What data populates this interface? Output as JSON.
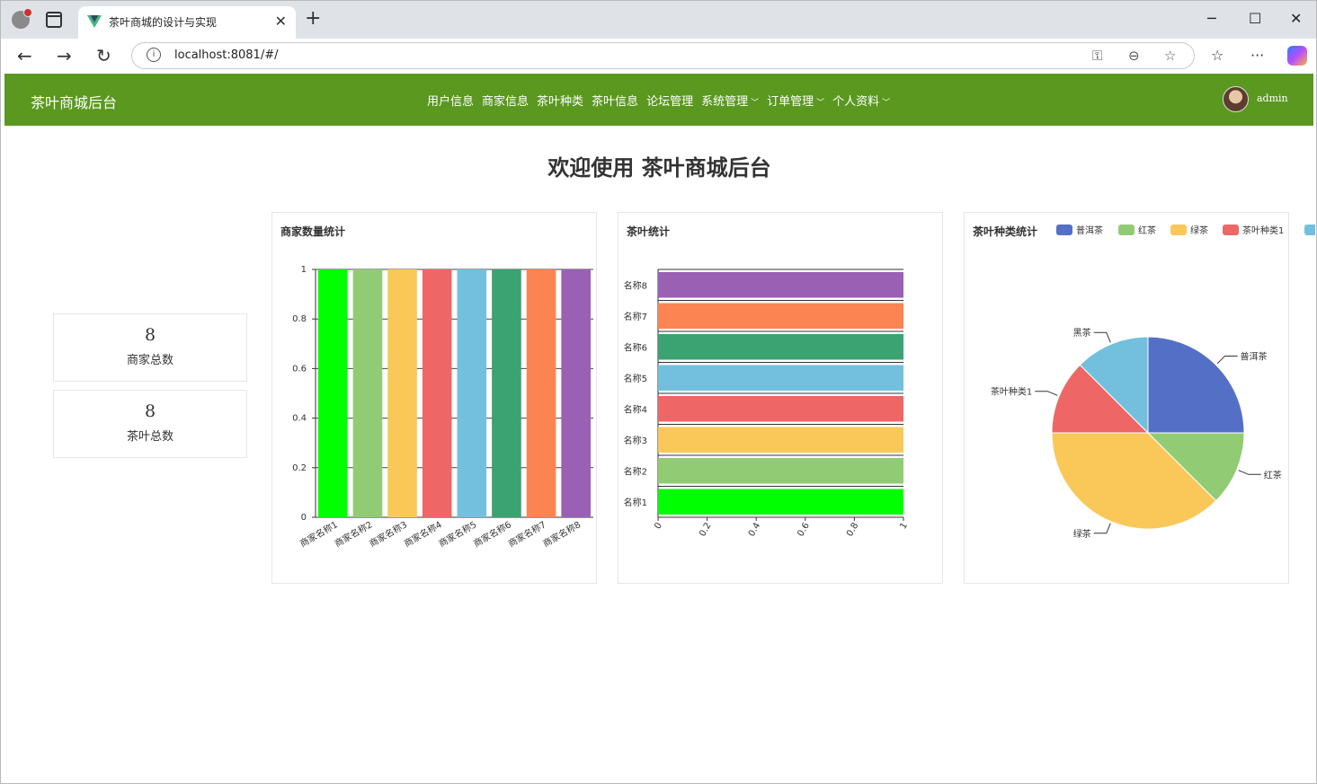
{
  "browser": {
    "tab_title": "茶叶商城的设计与实现",
    "url": "localhost:8081/#/"
  },
  "header": {
    "brand": "茶叶商城后台",
    "menu": [
      {
        "label": "用户信息",
        "dropdown": false
      },
      {
        "label": "商家信息",
        "dropdown": false
      },
      {
        "label": "茶叶种类",
        "dropdown": false
      },
      {
        "label": "茶叶信息",
        "dropdown": false
      },
      {
        "label": "论坛管理",
        "dropdown": false
      },
      {
        "label": "系统管理",
        "dropdown": true
      },
      {
        "label": "订单管理",
        "dropdown": true
      },
      {
        "label": "个人资料",
        "dropdown": true
      }
    ],
    "username": "admin"
  },
  "page": {
    "title": "欢迎使用 茶叶商城后台"
  },
  "stats": [
    {
      "value": "8",
      "label": "商家总数"
    },
    {
      "value": "8",
      "label": "茶叶总数"
    }
  ],
  "colors": {
    "header_bg": "#5a9820",
    "bar_palette": [
      "#00ff00",
      "#91cc75",
      "#fac858",
      "#ee6666",
      "#73c0de",
      "#3ba272",
      "#fc8452",
      "#9a60b4"
    ],
    "pie_palette": [
      "#5470c6",
      "#91cc75",
      "#fac858",
      "#ee6666",
      "#73c0de"
    ]
  },
  "chart_data": [
    {
      "type": "bar",
      "title": "商家数量统计",
      "categories": [
        "商家名称1",
        "商家名称2",
        "商家名称3",
        "商家名称4",
        "商家名称5",
        "商家名称6",
        "商家名称7",
        "商家名称8"
      ],
      "values": [
        1,
        1,
        1,
        1,
        1,
        1,
        1,
        1
      ],
      "ylim": [
        0,
        1
      ],
      "yticks": [
        "0",
        "0.2",
        "0.4",
        "0.6",
        "0.8",
        "1"
      ],
      "grid": true
    },
    {
      "type": "bar",
      "orientation": "horizontal",
      "title": "茶叶统计",
      "categories": [
        "名称1",
        "名称2",
        "名称3",
        "名称4",
        "名称5",
        "名称6",
        "名称7",
        "名称8"
      ],
      "values": [
        1,
        1,
        1,
        1,
        1,
        1,
        1,
        1
      ],
      "xlim": [
        0,
        1
      ],
      "xticks": [
        "0",
        "0.2",
        "0.4",
        "0.6",
        "0.8",
        "1"
      ]
    },
    {
      "type": "pie",
      "title": "茶叶种类统计",
      "legend_position": "top",
      "labels": [
        "普洱茶",
        "红茶",
        "绿茶",
        "茶叶种类1",
        "黑茶"
      ],
      "values": [
        2,
        1,
        3,
        1,
        1
      ]
    }
  ]
}
